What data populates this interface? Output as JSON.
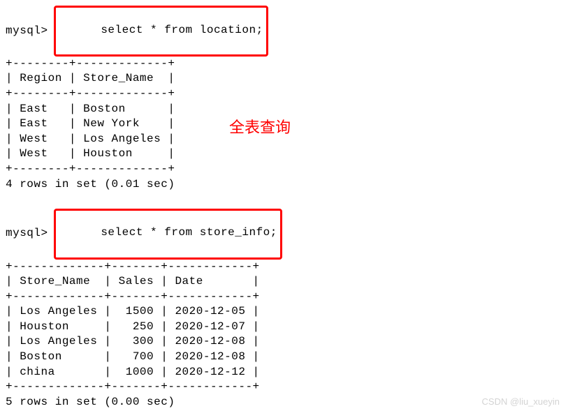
{
  "prompt": "mysql> ",
  "query1": {
    "sql": "select * from location;",
    "border_line": "+--------+-------------+",
    "header": "| Region | Store_Name  |",
    "rows": [
      "| East   | Boston      |",
      "| East   | New York    |",
      "| West   | Los Angeles |",
      "| West   | Houston     |"
    ],
    "footer": "4 rows in set (0.01 sec)"
  },
  "annotation1": "全表查询",
  "query2": {
    "sql": "select * from store_info;",
    "border_line": "+-------------+-------+------------+",
    "header": "| Store_Name  | Sales | Date       |",
    "rows": [
      "| Los Angeles |  1500 | 2020-12-05 |",
      "| Houston     |   250 | 2020-12-07 |",
      "| Los Angeles |   300 | 2020-12-08 |",
      "| Boston      |   700 | 2020-12-08 |",
      "| china       |  1000 | 2020-12-12 |"
    ],
    "footer": "5 rows in set (0.00 sec)"
  },
  "watermark": "CSDN @liu_xueyin",
  "chart_data": [
    {
      "type": "table",
      "title": "location",
      "columns": [
        "Region",
        "Store_Name"
      ],
      "rows": [
        [
          "East",
          "Boston"
        ],
        [
          "East",
          "New York"
        ],
        [
          "West",
          "Los Angeles"
        ],
        [
          "West",
          "Houston"
        ]
      ]
    },
    {
      "type": "table",
      "title": "store_info",
      "columns": [
        "Store_Name",
        "Sales",
        "Date"
      ],
      "rows": [
        [
          "Los Angeles",
          1500,
          "2020-12-05"
        ],
        [
          "Houston",
          250,
          "2020-12-07"
        ],
        [
          "Los Angeles",
          300,
          "2020-12-08"
        ],
        [
          "Boston",
          700,
          "2020-12-08"
        ],
        [
          "china",
          1000,
          "2020-12-12"
        ]
      ]
    }
  ]
}
